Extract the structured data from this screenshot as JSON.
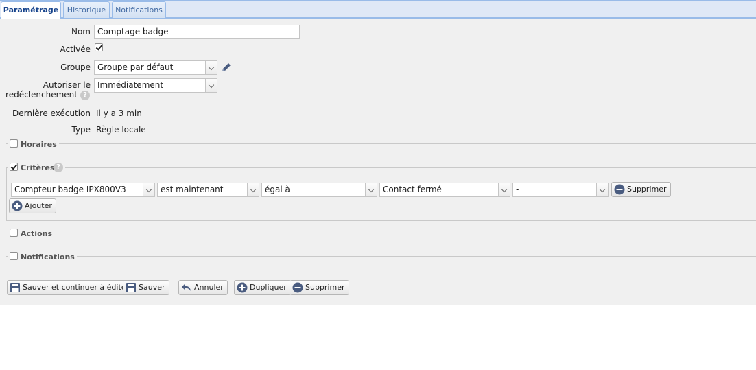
{
  "tabs": [
    {
      "label": "Paramétrage",
      "active": true
    },
    {
      "label": "Historique",
      "active": false
    },
    {
      "label": "Notifications",
      "active": false
    }
  ],
  "form": {
    "name": {
      "label": "Nom",
      "value": "Comptage badge"
    },
    "enabled": {
      "label": "Activée",
      "checked": true
    },
    "group": {
      "label": "Groupe",
      "value": "Groupe par défaut"
    },
    "retrigger": {
      "label_line1": "Autoriser le",
      "label_line2": "redéclenchement",
      "value": "Immédiatement"
    },
    "last_run": {
      "label": "Dernière exécution",
      "value": "Il y a 3 min"
    },
    "type": {
      "label": "Type",
      "value": "Règle locale"
    }
  },
  "sections": {
    "schedules": {
      "label": "Horaires",
      "checked": false
    },
    "criteria": {
      "label": "Critères",
      "checked": true
    },
    "actions": {
      "label": "Actions",
      "checked": false
    },
    "notifications": {
      "label": "Notifications",
      "checked": false
    }
  },
  "criteria_row": {
    "device": "Compteur badge IPX800V3",
    "state": "est maintenant",
    "operator": "égal à",
    "value": "Contact fermé",
    "extra": "-",
    "delete_label": "Supprimer"
  },
  "add_label": "Ajouter",
  "footer": {
    "save_continue": "Sauver et continuer à éditer",
    "save": "Sauver",
    "cancel": "Annuler",
    "duplicate": "Dupliquer",
    "delete": "Supprimer"
  },
  "colors": {
    "tab_border": "#99bbe8",
    "tab_active_text": "#15428b",
    "panel_bg": "#f0f0f0",
    "help_icon": "#c9c9c9",
    "icon_blue": "#4a5c80"
  }
}
